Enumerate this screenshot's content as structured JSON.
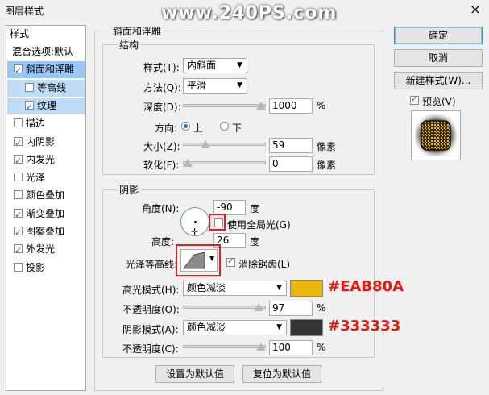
{
  "window": {
    "title": "图层样式",
    "close": "×",
    "watermark": "www.240PS.com"
  },
  "left_panel": {
    "header": "样式",
    "items": [
      {
        "label": "混合选项:默认",
        "checkbox": false,
        "checked": false,
        "state": "normal",
        "indent": false
      },
      {
        "label": "斜面和浮雕",
        "checkbox": true,
        "checked": true,
        "state": "selected",
        "indent": false
      },
      {
        "label": "等高线",
        "checkbox": true,
        "checked": false,
        "state": "subselected",
        "indent": true
      },
      {
        "label": "纹理",
        "checkbox": true,
        "checked": true,
        "state": "subselected",
        "indent": true
      },
      {
        "label": "描边",
        "checkbox": true,
        "checked": false,
        "state": "normal",
        "indent": false
      },
      {
        "label": "内阴影",
        "checkbox": true,
        "checked": true,
        "state": "normal",
        "indent": false
      },
      {
        "label": "内发光",
        "checkbox": true,
        "checked": true,
        "state": "normal",
        "indent": false
      },
      {
        "label": "光泽",
        "checkbox": true,
        "checked": false,
        "state": "normal",
        "indent": false
      },
      {
        "label": "颜色叠加",
        "checkbox": true,
        "checked": false,
        "state": "normal",
        "indent": false
      },
      {
        "label": "渐变叠加",
        "checkbox": true,
        "checked": true,
        "state": "normal",
        "indent": false
      },
      {
        "label": "图案叠加",
        "checkbox": true,
        "checked": true,
        "state": "normal",
        "indent": false
      },
      {
        "label": "外发光",
        "checkbox": true,
        "checked": true,
        "state": "normal",
        "indent": false
      },
      {
        "label": "投影",
        "checkbox": true,
        "checked": false,
        "state": "normal",
        "indent": false
      }
    ]
  },
  "bevel": {
    "section_title": "斜面和浮雕",
    "structure": {
      "title": "结构",
      "style_label": "样式(T):",
      "style_value": "内斜面",
      "technique_label": "方法(Q):",
      "technique_value": "平滑",
      "depth_label": "深度(D):",
      "depth_value": "1000",
      "depth_unit": "%",
      "depth_fraction": 1.0,
      "direction_label": "方向:",
      "direction_up": "上",
      "direction_down": "下",
      "direction_selected": "上",
      "size_label": "大小(Z):",
      "size_value": "59",
      "size_unit": "像素",
      "size_fraction": 0.24,
      "soften_label": "软化(F):",
      "soften_value": "0",
      "soften_unit": "像素",
      "soften_fraction": 0.0
    },
    "shading": {
      "title": "阴影",
      "angle_label": "角度(N):",
      "angle_value": "-90",
      "angle_unit": "度",
      "global_light_label": "使用全局光(G)",
      "global_light_checked": false,
      "altitude_label": "高度:",
      "altitude_value": "26",
      "altitude_unit": "度",
      "gloss_contour_label": "光泽等高线:",
      "antialias_label": "消除锯齿(L)",
      "antialias_checked": true,
      "highlight_mode_label": "高光模式(H):",
      "highlight_mode_value": "颜色减淡",
      "highlight_color": "#EAB80A",
      "highlight_color_text": "#EAB80A",
      "highlight_opacity_label": "不透明度(O):",
      "highlight_opacity_value": "97",
      "highlight_opacity_unit": "%",
      "highlight_opacity_fraction": 0.97,
      "shadow_mode_label": "阴影模式(A):",
      "shadow_mode_value": "颜色减淡",
      "shadow_color": "#333333",
      "shadow_color_text": "#333333",
      "shadow_opacity_label": "不透明度(C):",
      "shadow_opacity_value": "100",
      "shadow_opacity_unit": "%",
      "shadow_opacity_fraction": 1.0
    },
    "make_default": "设置为默认值",
    "reset_default": "复位为默认值"
  },
  "right": {
    "ok": "确定",
    "cancel": "取消",
    "new_style": "新建样式(W)...",
    "preview_label": "预览(V)",
    "preview_checked": true
  },
  "icons": {
    "checkmark": "checkmark-icon",
    "dropdown": "chevron-down-icon",
    "close": "close-icon"
  }
}
